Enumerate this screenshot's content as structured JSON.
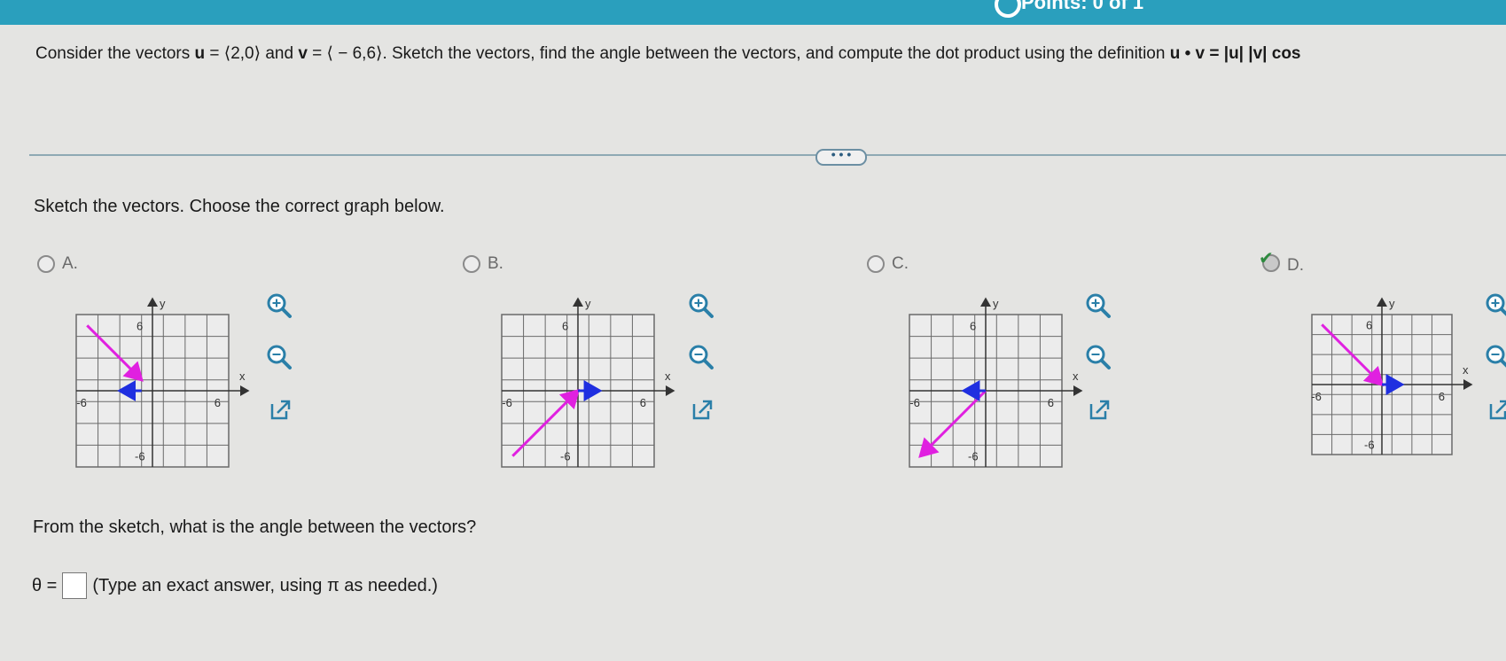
{
  "header": {
    "points_label": "Points: 0 of 1"
  },
  "question": {
    "intro": "Consider the vectors ",
    "u_name": "u",
    "u_value": " = ⟨2,0⟩",
    "and_text": " and ",
    "v_name": "v",
    "v_value": " = ⟨ − 6,6⟩",
    "rest": ". Sketch the vectors, find the angle between the vectors, and compute the dot product using the definition ",
    "definition": "u • v = |u| |v| cos"
  },
  "more_button": "• • •",
  "prompt": "Sketch the vectors. Choose the correct graph below.",
  "options": [
    {
      "letter": "A.",
      "selected": false,
      "correct": false
    },
    {
      "letter": "B.",
      "selected": false,
      "correct": false
    },
    {
      "letter": "C.",
      "selected": false,
      "correct": false
    },
    {
      "letter": "D.",
      "selected": true,
      "correct": true
    }
  ],
  "graph_labels": {
    "x": "x",
    "y": "y",
    "pos": "6",
    "neg": "-6"
  },
  "colors": {
    "u": "#1f2fe0",
    "v": "#e020e0",
    "grid": "#6a6a6a",
    "tool": "#2a7fa8",
    "accent": "#2a9fbd"
  },
  "tools": [
    "zoom-in-icon",
    "zoom-out-icon",
    "external-link-icon"
  ],
  "sketch_question": "From the sketch, what is the angle between the vectors?",
  "answer": {
    "theta": "θ =",
    "hint": "(Type an exact answer, using π as needed.)"
  }
}
